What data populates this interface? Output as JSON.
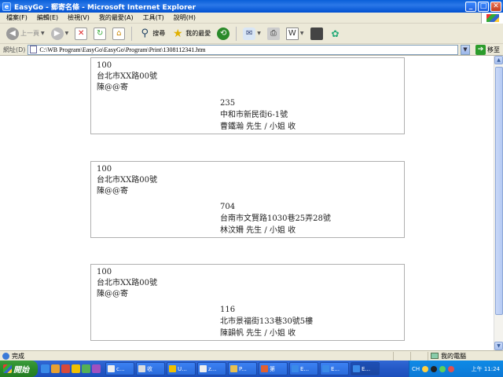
{
  "window": {
    "title": "EasyGo - 郵寄名條 - Microsoft Internet Explorer",
    "minimize": "_",
    "maximize": "□",
    "close": "✕"
  },
  "menu": [
    "檔案(F)",
    "編輯(E)",
    "檢視(V)",
    "我的最愛(A)",
    "工具(T)",
    "說明(H)"
  ],
  "toolbar": {
    "back_label": "上一頁",
    "search_label": "搜尋",
    "favorites_label": "我的最愛"
  },
  "address": {
    "label": "網址(D)",
    "url": "C:\\WB Program\\EasyGo\\EasyGo\\Program\\Print\\1308112341.htm",
    "go_label": "移至"
  },
  "envelopes": [
    {
      "sender_zip": "100",
      "sender_address": "台北市XX路00號",
      "sender_name": "陳@@寄",
      "recipient_zip": "235",
      "recipient_address": "中和市新民街6-1號",
      "recipient_name": "曹鐵瀚 先生 / 小姐 收"
    },
    {
      "sender_zip": "100",
      "sender_address": "台北市XX路00號",
      "sender_name": "陳@@寄",
      "recipient_zip": "704",
      "recipient_address": "台南市文賢路1030巷25弄28號",
      "recipient_name": "林汶姍 先生 / 小姐 收"
    },
    {
      "sender_zip": "100",
      "sender_address": "台北市XX路00號",
      "sender_name": "陳@@寄",
      "recipient_zip": "116",
      "recipient_address": "北市景福街133巷30號5樓",
      "recipient_name": "陳韻帆 先生 / 小姐 收"
    }
  ],
  "status": {
    "left_text": "完成",
    "zone_text": "我的電腦"
  },
  "taskbar": {
    "start_label": "開始",
    "tasks": [
      "c...",
      "收",
      "U...",
      "z...",
      "P...",
      "第",
      "E...",
      "E...",
      "E..."
    ],
    "lang": "CH",
    "clock": "上午 11:24"
  },
  "colors": {
    "titlebar": "#0a5fd8",
    "taskbar": "#2458c6",
    "start": "#2a8a2a",
    "tray": "#0f8ae6"
  }
}
